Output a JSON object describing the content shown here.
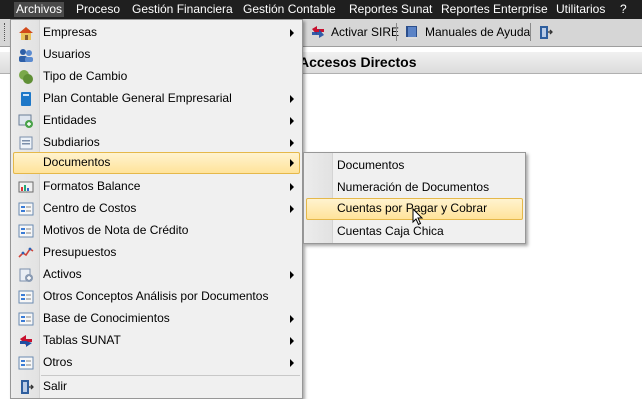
{
  "menubar": {
    "items": [
      {
        "label": "Archivos"
      },
      {
        "label": "Proceso"
      },
      {
        "label": "Gestión Financiera"
      },
      {
        "label": "Gestión Contable"
      },
      {
        "label": "Reportes Sunat"
      },
      {
        "label": "Reportes Enterprise"
      },
      {
        "label": "Utilitarios"
      },
      {
        "label": "?"
      }
    ]
  },
  "toolbar": {
    "activar_sire": "Activar SIRE",
    "manuales": "Manuales de Ayuda"
  },
  "panel": {
    "title": "Accesos Directos"
  },
  "archivos_menu": {
    "items": [
      {
        "label": "Empresas",
        "icon": "house-icon"
      },
      {
        "label": "Usuarios",
        "icon": "users-icon"
      },
      {
        "label": "Tipo de Cambio",
        "icon": "currency-icon"
      },
      {
        "label": "Plan Contable General Empresarial",
        "icon": "book-icon"
      },
      {
        "label": "Entidades",
        "icon": "entities-icon"
      },
      {
        "label": "Subdiarios",
        "icon": "subdiary-icon"
      },
      {
        "label": "Documentos",
        "icon": "documents-icon"
      },
      {
        "label": "Formatos Balance",
        "icon": "balance-icon"
      },
      {
        "label": "Centro de Costos",
        "icon": "form-icon"
      },
      {
        "label": "Motivos de Nota de Crédito",
        "icon": "form-icon"
      },
      {
        "label": "Presupuestos",
        "icon": "chart-line-icon"
      },
      {
        "label": "Activos",
        "icon": "assets-icon"
      },
      {
        "label": "Otros Conceptos Análisis por Documentos",
        "icon": "form-icon"
      },
      {
        "label": "Base de Conocimientos",
        "icon": "form-icon"
      },
      {
        "label": "Tablas SUNAT",
        "icon": "sunat-icon"
      },
      {
        "label": "Otros",
        "icon": "form-icon"
      },
      {
        "label": "Salir",
        "icon": "exit-icon"
      }
    ]
  },
  "documentos_submenu": {
    "items": [
      {
        "label": "Documentos"
      },
      {
        "label": "Numeración de Documentos"
      },
      {
        "label": "Cuentas por Pagar y Cobrar"
      },
      {
        "label": "Cuentas Caja Chica"
      }
    ]
  }
}
